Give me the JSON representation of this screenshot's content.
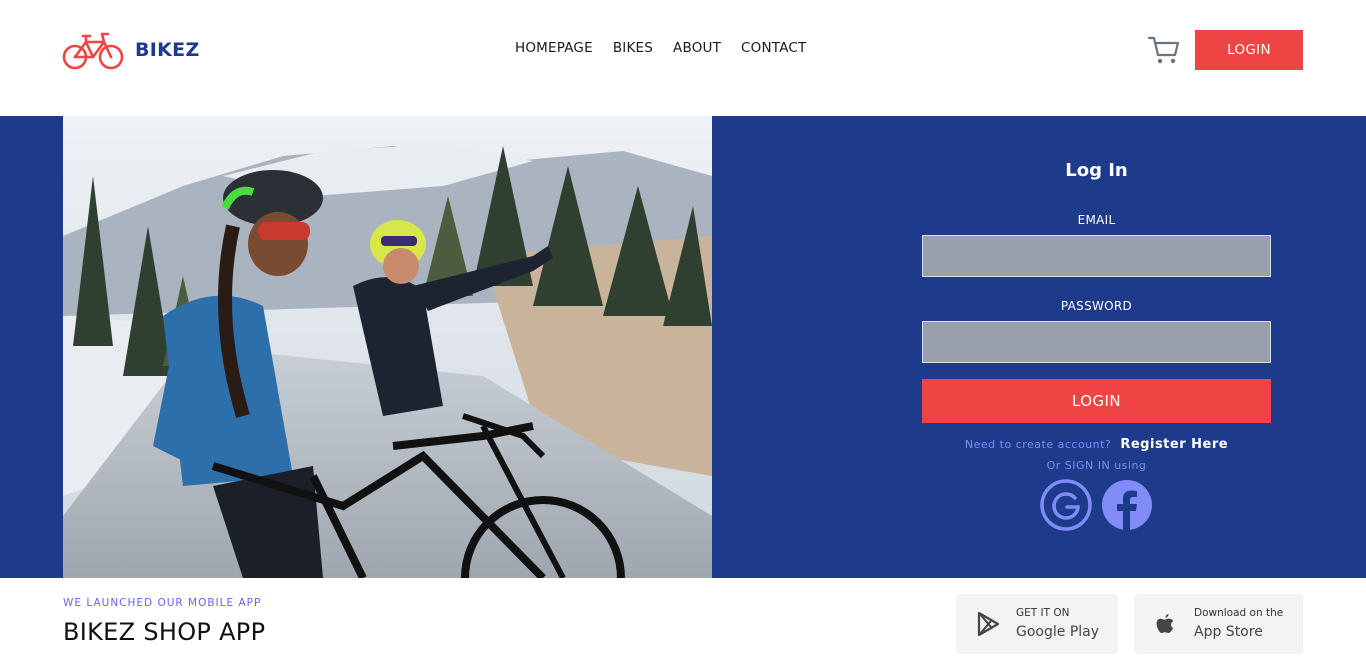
{
  "header": {
    "brand": "BIKEZ",
    "nav": [
      "HOMEPAGE",
      "BIKES",
      "ABOUT",
      "CONTACT"
    ],
    "login_label": "LOGIN",
    "icons": {
      "logo": "bicycle-icon",
      "cart": "cart-icon"
    }
  },
  "form": {
    "title": "Log In",
    "email_label": "EMAIL",
    "email_value": "",
    "password_label": "PASSWORD",
    "password_value": "",
    "submit_label": "LOGIN",
    "register_prompt": "Need to create account?",
    "register_link": "Register Here",
    "or_text": "Or SIGN IN using",
    "social": [
      "google-icon",
      "facebook-icon"
    ]
  },
  "footer": {
    "kicker": "WE LAUNCHED OUR MOBILE APP",
    "title": "BIKEZ SHOP APP",
    "google_play": {
      "small": "GET IT ON",
      "big": "Google Play"
    },
    "app_store": {
      "small": "Download on the",
      "big": "App Store"
    }
  },
  "colors": {
    "brand_blue": "#1e3a8a",
    "accent_red": "#ef4444",
    "input_gray": "#9aa0ab",
    "link_indigo": "#818cf8"
  }
}
